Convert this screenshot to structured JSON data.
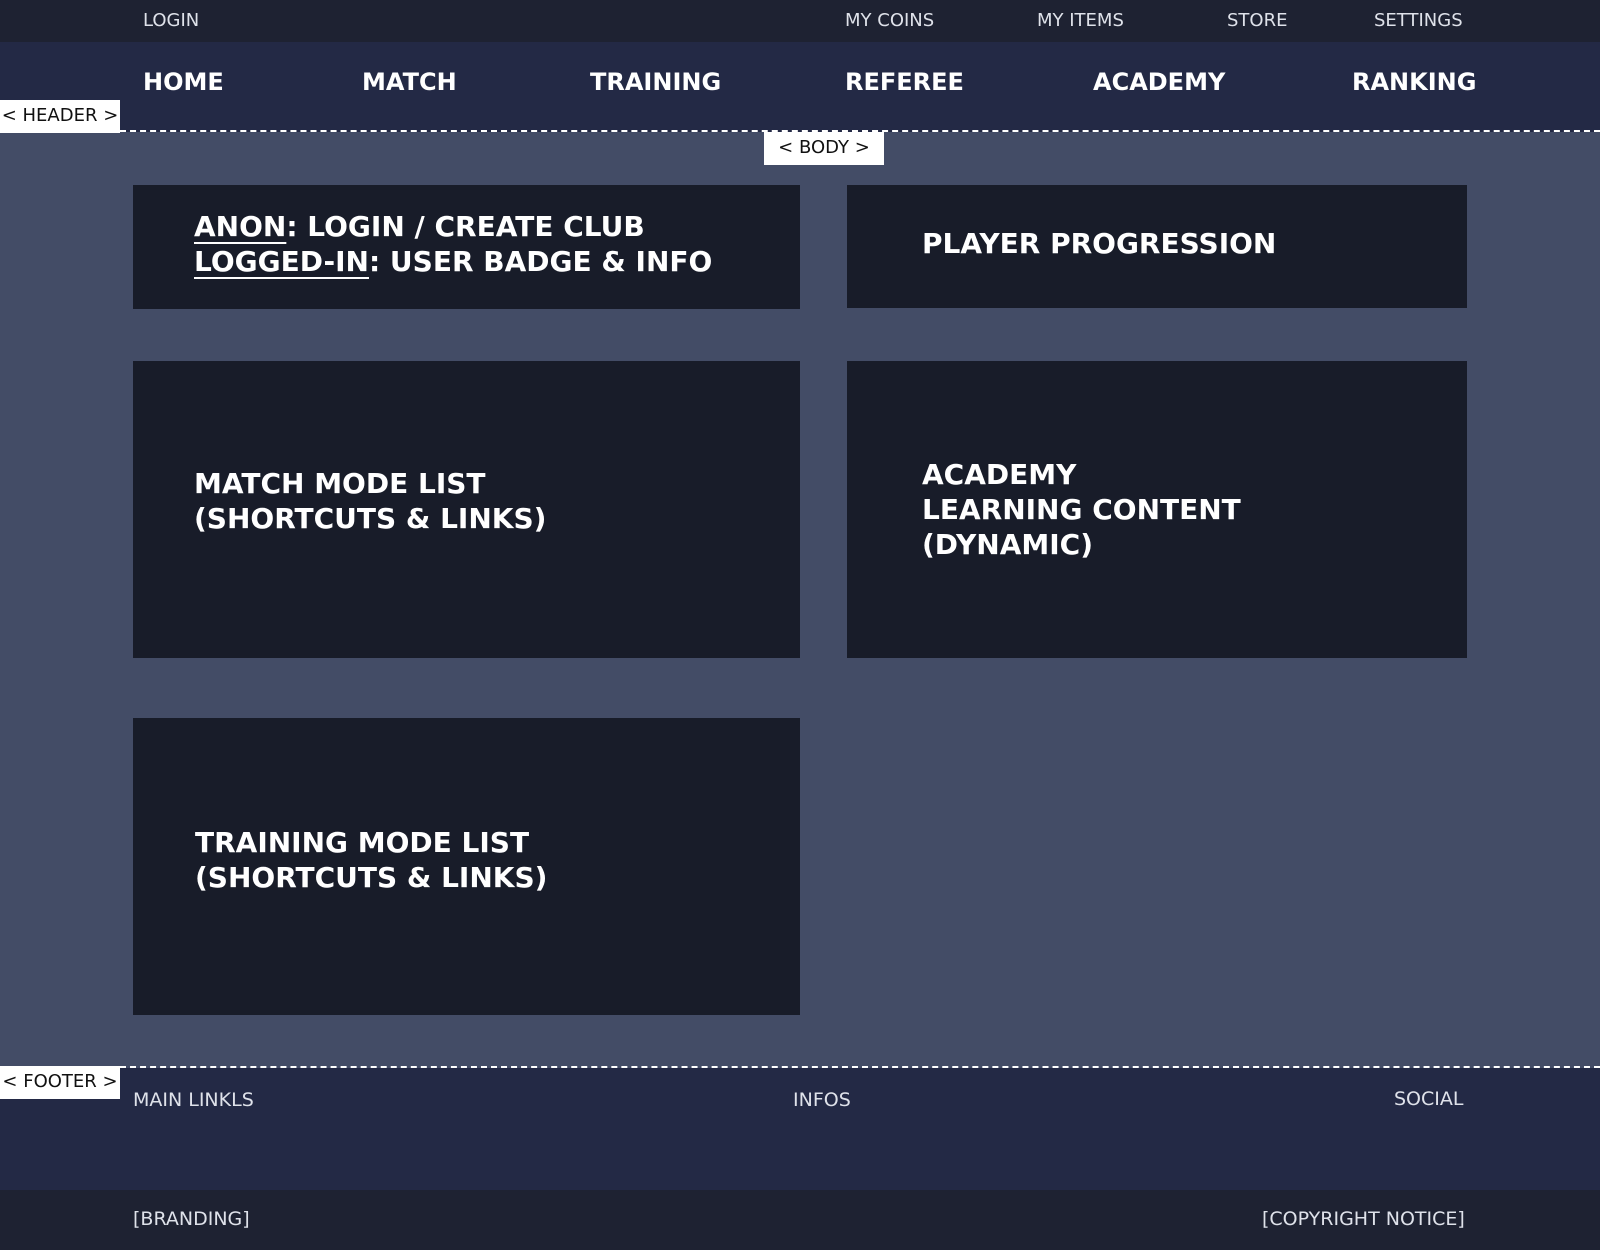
{
  "topbar": {
    "login": "LOGIN",
    "my_coins": "MY COINS",
    "my_items": "MY ITEMS",
    "store": "STORE",
    "settings": "SETTINGS"
  },
  "nav": {
    "items": [
      "HOME",
      "MATCH",
      "TRAINING",
      "REFEREE",
      "ACADEMY",
      "RANKING"
    ]
  },
  "tags": {
    "header": "< HEADER >",
    "body": "< BODY >",
    "footer": "< FOOTER >"
  },
  "cards": {
    "login": {
      "anon_label": "ANON",
      "anon_text": ": LOGIN / CREATE CLUB",
      "logged_label": "LOGGED-IN",
      "logged_text": ": USER BADGE & INFO"
    },
    "progression": {
      "title": "PLAYER PROGRESSION"
    },
    "match": {
      "line1": "MATCH MODE LIST",
      "line2": "(SHORTCUTS & LINKS)"
    },
    "academy": {
      "line1": "ACADEMY",
      "line2": "LEARNING CONTENT",
      "line3": "(DYNAMIC)"
    },
    "training": {
      "line1": "TRAINING MODE LIST",
      "line2": "(SHORTCUTS & LINKS)"
    }
  },
  "footer": {
    "main_links": "MAIN LINKLS",
    "infos": "INFOS",
    "social": "SOCIAL",
    "branding": "[BRANDING]",
    "copyright": "[COPYRIGHT NOTICE]"
  }
}
